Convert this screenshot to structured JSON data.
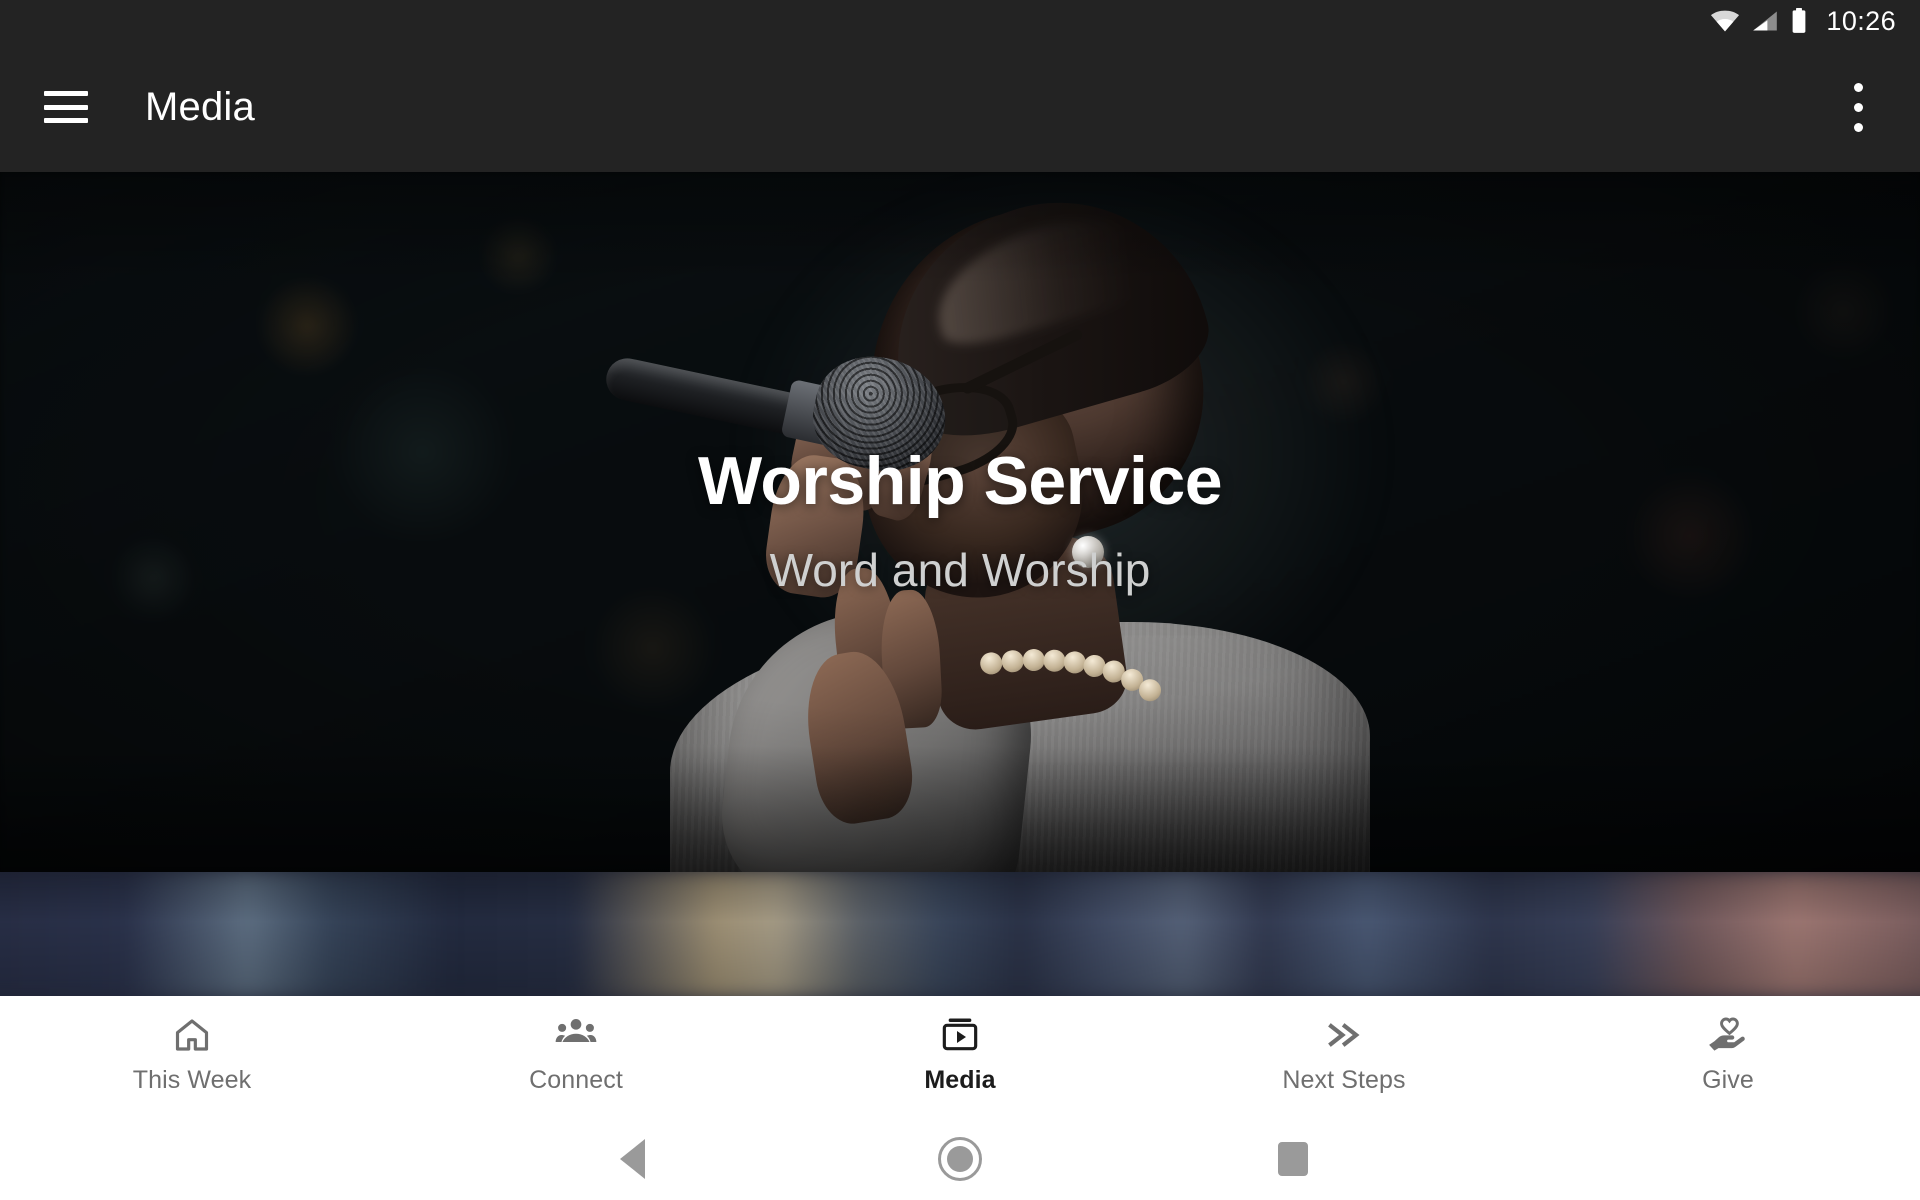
{
  "status_bar": {
    "time": "10:26",
    "icons": [
      "wifi-icon",
      "cellular-signal-icon",
      "battery-icon"
    ]
  },
  "app_bar": {
    "menu_icon": "hamburger-menu-icon",
    "title": "Media",
    "overflow_icon": "more-vert-icon"
  },
  "hero": {
    "title": "Worship Service",
    "subtitle": "Word and Worship",
    "image_description": "Woman singing into a handheld microphone on a dark stage",
    "title_color": "#ffffff",
    "subtitle_color": "#cfd0d0"
  },
  "hero_secondary": {
    "image_description": "Partially visible next media card, blurred dark blue stage photo"
  },
  "bottom_nav": {
    "active_index": 2,
    "active_color": "#1c1c1c",
    "inactive_color": "#6f6f6f",
    "items": [
      {
        "label": "This Week",
        "icon": "home-icon"
      },
      {
        "label": "Connect",
        "icon": "people-group-icon"
      },
      {
        "label": "Media",
        "icon": "subscriptions-play-icon"
      },
      {
        "label": "Next Steps",
        "icon": "double-chevron-right-icon"
      },
      {
        "label": "Give",
        "icon": "hand-heart-icon"
      }
    ]
  },
  "system_nav": {
    "back_icon": "triangle-back-icon",
    "home_icon": "circle-home-icon",
    "recents_icon": "square-recents-icon",
    "icon_color": "#9a9a9a"
  }
}
